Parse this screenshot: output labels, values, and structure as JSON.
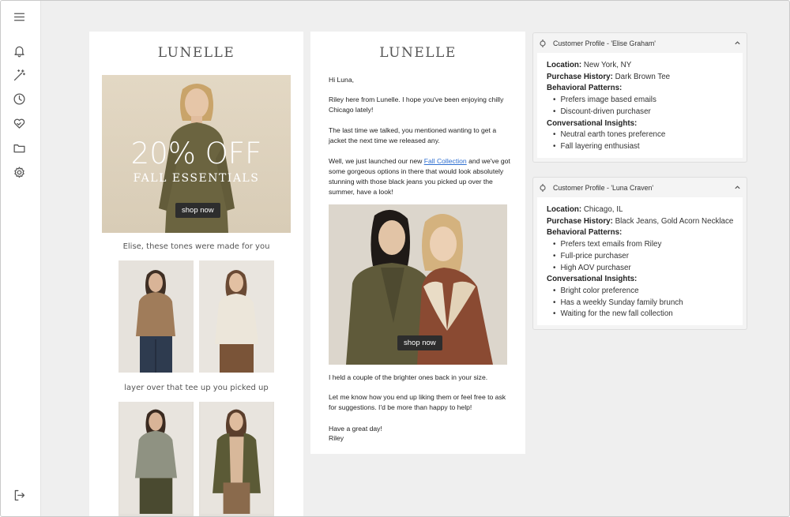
{
  "sidebar": {
    "items": [
      {
        "name": "menu-icon"
      },
      {
        "name": "bell-icon"
      },
      {
        "name": "magic-wand-icon"
      },
      {
        "name": "clock-icon"
      },
      {
        "name": "heart-handshake-icon"
      },
      {
        "name": "folder-icon"
      },
      {
        "name": "gear-icon"
      },
      {
        "name": "logout-icon"
      }
    ]
  },
  "email1": {
    "brand": "LUNELLE",
    "hero_title": "20% OFF",
    "hero_subtitle": "FALL ESSENTIALS",
    "hero_button": "shop now",
    "caption1": "Elise, these tones were made for you",
    "caption2": "layer over that tee up you picked up"
  },
  "email2": {
    "brand": "LUNELLE",
    "greeting": "Hi Luna,",
    "p1": "Riley here from Lunelle. I hope you've been enjoying chilly Chicago lately!",
    "p2": "The last time we talked, you mentioned wanting to get a jacket the next time we released any.",
    "p3_before": "Well, we just launched our new ",
    "p3_link": "Fall Collection",
    "p3_after": " and we've got some gorgeous options in there that would look absolutely stunning with those black jeans you picked up over the summer, have a look!",
    "photo_button": "shop now",
    "p4": "I held a couple of the brighter ones back in your size.",
    "p5": "Let me know how you end up liking them or feel free to ask for suggestions. I'd be more than happy to help!",
    "signoff": "Have a great day!",
    "signature": "Riley"
  },
  "profiles": [
    {
      "title": "Customer Profile - 'Elise Graham'",
      "location_label": "Location:",
      "location": "New York, NY",
      "purchase_label": "Purchase History:",
      "purchase": "Dark Brown Tee",
      "behavior_label": "Behavioral Patterns:",
      "behavior": [
        "Prefers image based emails",
        "Discount-driven purchaser"
      ],
      "insights_label": "Conversational Insights:",
      "insights": [
        "Neutral earth tones preference",
        "Fall layering enthusiast"
      ]
    },
    {
      "title": "Customer Profile - 'Luna Craven'",
      "location_label": "Location:",
      "location": "Chicago, IL",
      "purchase_label": "Purchase History:",
      "purchase": "Black Jeans, Gold Acorn Necklace",
      "behavior_label": "Behavioral Patterns:",
      "behavior": [
        "Prefers text emails from Riley",
        "Full-price purchaser",
        "High AOV purchaser"
      ],
      "insights_label": "Conversational Insights:",
      "insights": [
        "Bright color preference",
        "Has a weekly Sunday family brunch",
        "Waiting for the new fall collection"
      ]
    }
  ],
  "colors": {
    "background": "#efefef",
    "link": "#2f6fd0",
    "button": "#2d2d2d"
  }
}
